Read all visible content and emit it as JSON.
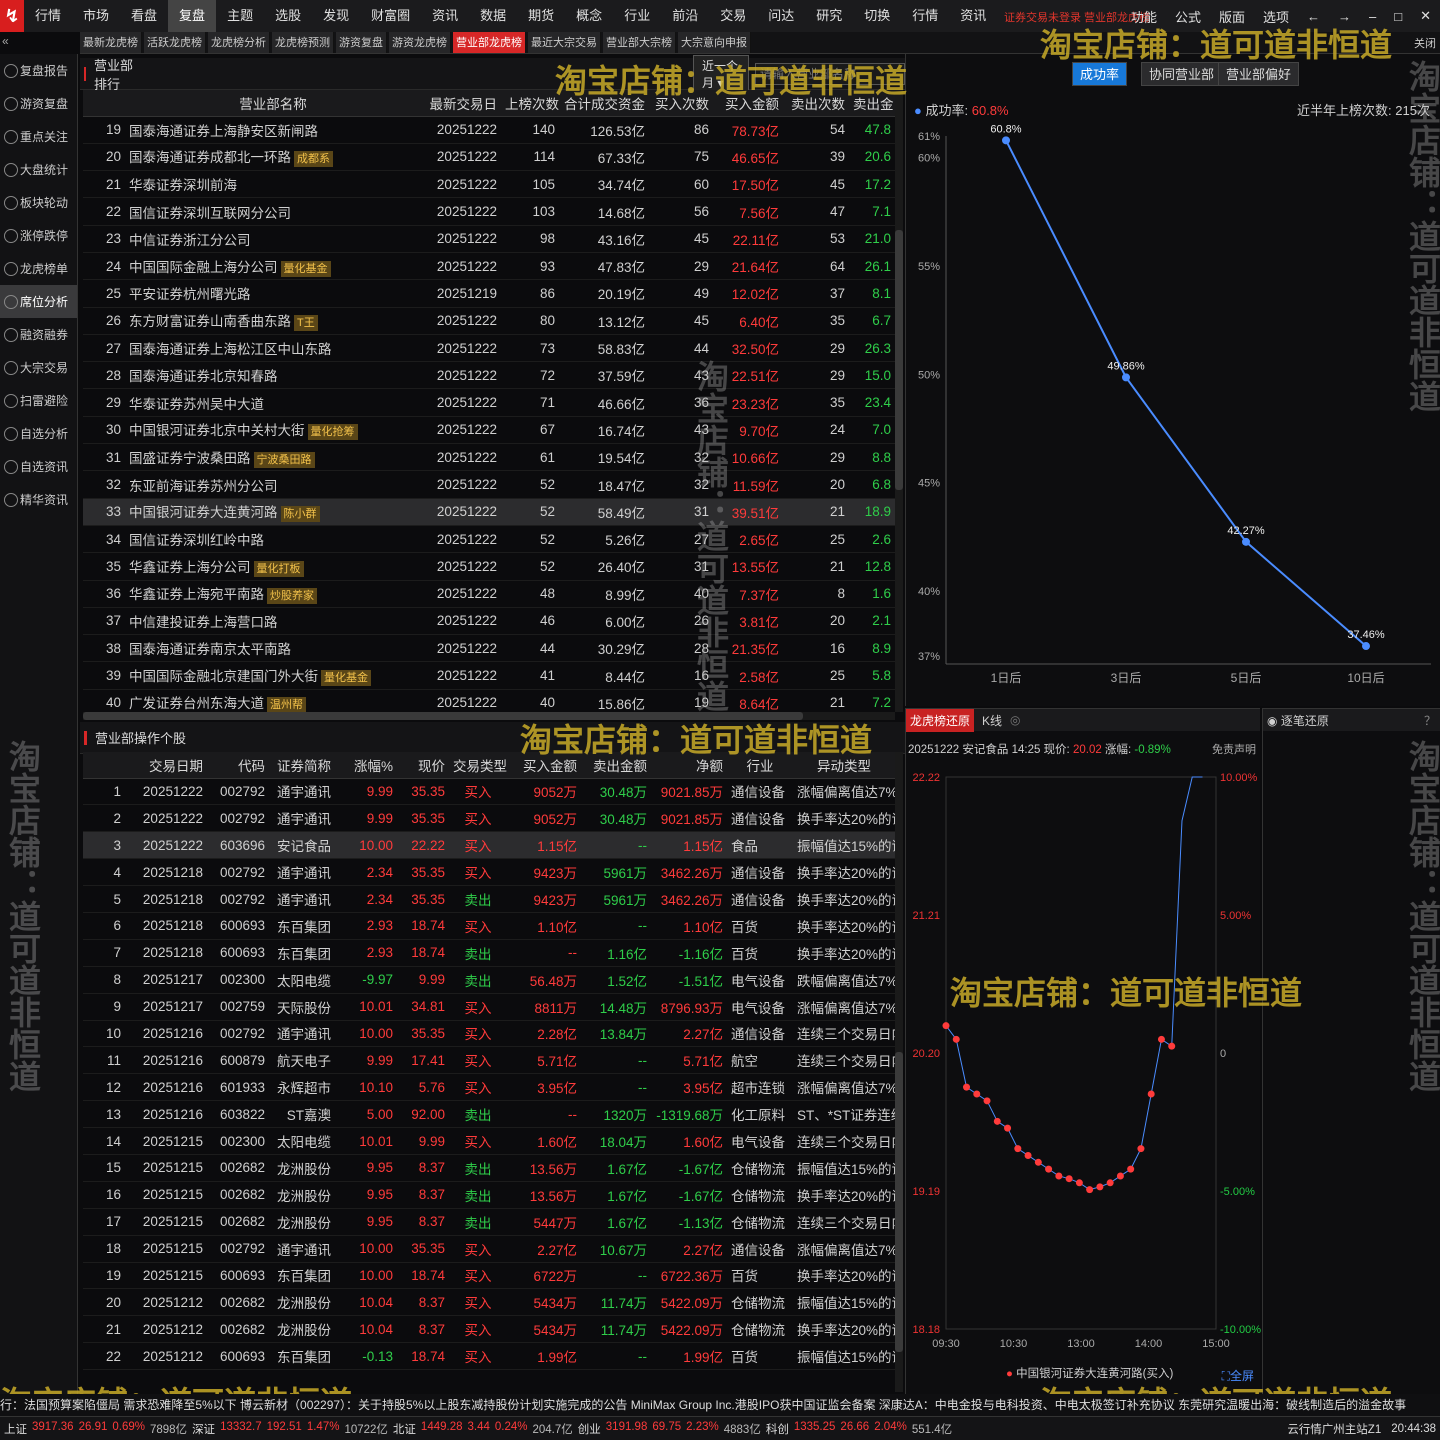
{
  "menu": [
    "行情",
    "市场",
    "看盘",
    "复盘",
    "主题",
    "选股",
    "发现",
    "财富圈",
    "资讯",
    "数据",
    "期货",
    "概念",
    "行业",
    "前沿",
    "交易",
    "问达",
    "研究",
    "切换",
    "行情",
    "资讯"
  ],
  "menu_active": 3,
  "header_red": "证券交易未登录  营业部龙虎榜",
  "right_menu": [
    "功能",
    "公式",
    "版面",
    "选项"
  ],
  "subtabs": [
    "最新龙虎榜",
    "活跃龙虎榜",
    "龙虎榜分析",
    "龙虎榜预测",
    "游资复盘",
    "游资龙虎榜",
    "营业部龙虎榜",
    "最近大宗交易",
    "营业部大宗榜",
    "大宗意向申报"
  ],
  "subtab_active": 6,
  "close_label": "关闭",
  "sidebar": [
    "复盘报告",
    "游资复盘",
    "重点关注",
    "大盘统计",
    "板块轮动",
    "涨停跌停",
    "龙虎榜单",
    "席位分析",
    "融资融券",
    "大宗交易",
    "扫雷避险",
    "自选分析",
    "自选资讯",
    "精华资讯"
  ],
  "sidebar_active": 7,
  "rank": {
    "title": "营业部排行",
    "period": "近一个月",
    "search_placeholder": "请输入营业部名称",
    "headers": [
      "",
      "营业部名称",
      "最新交易日",
      "上榜次数",
      "合计成交资金",
      "买入次数",
      "买入金额",
      "卖出次数",
      "卖出金"
    ],
    "rows": [
      [
        "19",
        "国泰海通证券上海静安区新闸路",
        "",
        "20251222",
        "140",
        "126.53亿",
        "86",
        "78.73亿",
        "54",
        "47.8"
      ],
      [
        "20",
        "国泰海通证券成都北一环路",
        "成都系",
        "20251222",
        "114",
        "67.33亿",
        "75",
        "46.65亿",
        "39",
        "20.6"
      ],
      [
        "21",
        "华泰证券深圳前海",
        "",
        "20251222",
        "105",
        "34.74亿",
        "60",
        "17.50亿",
        "45",
        "17.2"
      ],
      [
        "22",
        "国信证券深圳互联网分公司",
        "",
        "20251222",
        "103",
        "14.68亿",
        "56",
        "7.56亿",
        "47",
        "7.1"
      ],
      [
        "23",
        "中信证券浙江分公司",
        "",
        "20251222",
        "98",
        "43.16亿",
        "45",
        "22.11亿",
        "53",
        "21.0"
      ],
      [
        "24",
        "中国国际金融上海分公司",
        "量化基金",
        "20251222",
        "93",
        "47.83亿",
        "29",
        "21.64亿",
        "64",
        "26.1"
      ],
      [
        "25",
        "平安证券杭州曙光路",
        "",
        "20251219",
        "86",
        "20.19亿",
        "49",
        "12.02亿",
        "37",
        "8.1"
      ],
      [
        "26",
        "东方财富证券山南香曲东路",
        "T王",
        "20251222",
        "80",
        "13.12亿",
        "45",
        "6.40亿",
        "35",
        "6.7"
      ],
      [
        "27",
        "国泰海通证券上海松江区中山东路",
        "",
        "20251222",
        "73",
        "58.83亿",
        "44",
        "32.50亿",
        "29",
        "26.3"
      ],
      [
        "28",
        "国泰海通证券北京知春路",
        "",
        "20251222",
        "72",
        "37.59亿",
        "43",
        "22.51亿",
        "29",
        "15.0"
      ],
      [
        "29",
        "华泰证券苏州吴中大道",
        "",
        "20251222",
        "71",
        "46.66亿",
        "36",
        "23.23亿",
        "35",
        "23.4"
      ],
      [
        "30",
        "中国银河证券北京中关村大街",
        "量化抢筹",
        "20251222",
        "67",
        "16.74亿",
        "43",
        "9.70亿",
        "24",
        "7.0"
      ],
      [
        "31",
        "国盛证券宁波桑田路",
        "宁波桑田路",
        "20251222",
        "61",
        "19.54亿",
        "32",
        "10.66亿",
        "29",
        "8.8"
      ],
      [
        "32",
        "东亚前海证券苏州分公司",
        "",
        "20251222",
        "52",
        "18.47亿",
        "32",
        "11.59亿",
        "20",
        "6.8"
      ],
      [
        "33",
        "中国银河证券大连黄河路",
        "陈小群",
        "20251222",
        "52",
        "58.49亿",
        "31",
        "39.51亿",
        "21",
        "18.9"
      ],
      [
        "34",
        "国信证券深圳红岭中路",
        "",
        "20251222",
        "52",
        "5.26亿",
        "27",
        "2.65亿",
        "25",
        "2.6"
      ],
      [
        "35",
        "华鑫证券上海分公司",
        "量化打板",
        "20251222",
        "52",
        "26.40亿",
        "31",
        "13.55亿",
        "21",
        "12.8"
      ],
      [
        "36",
        "华鑫证券上海宛平南路",
        "炒股养家",
        "20251222",
        "48",
        "8.99亿",
        "40",
        "7.37亿",
        "8",
        "1.6"
      ],
      [
        "37",
        "中信建投证券上海营口路",
        "",
        "20251222",
        "46",
        "6.00亿",
        "26",
        "3.81亿",
        "20",
        "2.1"
      ],
      [
        "38",
        "国泰海通证券南京太平南路",
        "",
        "20251222",
        "44",
        "30.29亿",
        "28",
        "21.35亿",
        "16",
        "8.9"
      ],
      [
        "39",
        "中国国际金融北京建国门外大街",
        "量化基金",
        "20251222",
        "41",
        "8.44亿",
        "16",
        "2.58亿",
        "25",
        "5.8"
      ],
      [
        "40",
        "广发证券台州东海大道",
        "温州帮",
        "20251222",
        "40",
        "15.86亿",
        "19",
        "8.64亿",
        "21",
        "7.2"
      ]
    ],
    "selected_row": 14
  },
  "ops": {
    "title": "营业部操作个股",
    "headers": [
      "",
      "交易日期",
      "代码",
      "证券简称",
      "涨幅%",
      "现价",
      "交易类型",
      "买入金额",
      "卖出金额",
      "净额",
      "行业",
      "异动类型"
    ],
    "rows": [
      [
        "1",
        "20251222",
        "002792",
        "通宇通讯",
        "9.99",
        "35.35",
        "买入",
        "9052万",
        "30.48万",
        "9021.85万",
        "通信设备",
        "涨幅偏离值达7%的"
      ],
      [
        "2",
        "20251222",
        "002792",
        "通宇通讯",
        "9.99",
        "35.35",
        "买入",
        "9052万",
        "30.48万",
        "9021.85万",
        "通信设备",
        "换手率达20%的证"
      ],
      [
        "3",
        "20251222",
        "603696",
        "安记食品",
        "10.00",
        "22.22",
        "买入",
        "1.15亿",
        "--",
        "1.15亿",
        "食品",
        "振幅值达15%的证"
      ],
      [
        "4",
        "20251218",
        "002792",
        "通宇通讯",
        "2.34",
        "35.35",
        "买入",
        "9423万",
        "5961万",
        "3462.26万",
        "通信设备",
        "换手率达20%的证"
      ],
      [
        "5",
        "20251218",
        "002792",
        "通宇通讯",
        "2.34",
        "35.35",
        "卖出",
        "9423万",
        "5961万",
        "3462.26万",
        "通信设备",
        "换手率达20%的证"
      ],
      [
        "6",
        "20251218",
        "600693",
        "东百集团",
        "2.93",
        "18.74",
        "买入",
        "1.10亿",
        "--",
        "1.10亿",
        "百货",
        "换手率达20%的证"
      ],
      [
        "7",
        "20251218",
        "600693",
        "东百集团",
        "2.93",
        "18.74",
        "卖出",
        "--",
        "1.16亿",
        "-1.16亿",
        "百货",
        "换手率达20%的证"
      ],
      [
        "8",
        "20251217",
        "002300",
        "太阳电缆",
        "-9.97",
        "9.99",
        "卖出",
        "56.48万",
        "1.52亿",
        "-1.51亿",
        "电气设备",
        "跌幅偏离值达7%的"
      ],
      [
        "9",
        "20251217",
        "002759",
        "天际股份",
        "10.01",
        "34.81",
        "买入",
        "8811万",
        "14.48万",
        "8796.93万",
        "电气设备",
        "涨幅偏离值达7%的"
      ],
      [
        "10",
        "20251216",
        "002792",
        "通宇通讯",
        "10.00",
        "35.35",
        "买入",
        "2.28亿",
        "13.84万",
        "2.27亿",
        "通信设备",
        "连续三个交易日内"
      ],
      [
        "11",
        "20251216",
        "600879",
        "航天电子",
        "9.99",
        "17.41",
        "买入",
        "5.71亿",
        "--",
        "5.71亿",
        "航空",
        "连续三个交易日内"
      ],
      [
        "12",
        "20251216",
        "601933",
        "永辉超市",
        "10.10",
        "5.76",
        "买入",
        "3.95亿",
        "--",
        "3.95亿",
        "超市连锁",
        "涨幅偏离值达7%的"
      ],
      [
        "13",
        "20251216",
        "603822",
        "ST嘉澳",
        "5.00",
        "92.00",
        "卖出",
        "--",
        "1320万",
        "-1319.68万",
        "化工原料",
        "ST、*ST证券连续"
      ],
      [
        "14",
        "20251215",
        "002300",
        "太阳电缆",
        "10.01",
        "9.99",
        "买入",
        "1.60亿",
        "18.04万",
        "1.60亿",
        "电气设备",
        "连续三个交易日内"
      ],
      [
        "15",
        "20251215",
        "002682",
        "龙洲股份",
        "9.95",
        "8.37",
        "卖出",
        "13.56万",
        "1.67亿",
        "-1.67亿",
        "仓储物流",
        "振幅值达15%的证"
      ],
      [
        "16",
        "20251215",
        "002682",
        "龙洲股份",
        "9.95",
        "8.37",
        "卖出",
        "13.56万",
        "1.67亿",
        "-1.67亿",
        "仓储物流",
        "换手率达20%的证"
      ],
      [
        "17",
        "20251215",
        "002682",
        "龙洲股份",
        "9.95",
        "8.37",
        "卖出",
        "5447万",
        "1.67亿",
        "-1.13亿",
        "仓储物流",
        "连续三个交易日内"
      ],
      [
        "18",
        "20251215",
        "002792",
        "通宇通讯",
        "10.00",
        "35.35",
        "买入",
        "2.27亿",
        "10.67万",
        "2.27亿",
        "通信设备",
        "涨幅偏离值达7%的"
      ],
      [
        "19",
        "20251215",
        "600693",
        "东百集团",
        "10.00",
        "18.74",
        "买入",
        "6722万",
        "--",
        "6722.36万",
        "百货",
        "换手率达20%的证"
      ],
      [
        "20",
        "20251212",
        "002682",
        "龙洲股份",
        "10.04",
        "8.37",
        "买入",
        "5434万",
        "11.74万",
        "5422.09万",
        "仓储物流",
        "振幅值达15%的证"
      ],
      [
        "21",
        "20251212",
        "002682",
        "龙洲股份",
        "10.04",
        "8.37",
        "买入",
        "5434万",
        "11.74万",
        "5422.09万",
        "仓储物流",
        "换手率达20%的证"
      ],
      [
        "22",
        "20251212",
        "600693",
        "东百集团",
        "-0.13",
        "18.74",
        "买入",
        "1.99亿",
        "--",
        "1.99亿",
        "百货",
        "振幅值达15%的证"
      ]
    ],
    "selected_row": 2
  },
  "tabs_right": [
    "成功率",
    "协同营业部",
    "营业部偏好"
  ],
  "success": {
    "label": "成功率:",
    "value": "60.8%",
    "count_label": "近半年上榜次数:",
    "count": "215次"
  },
  "chart_data": [
    {
      "type": "line",
      "title": "",
      "categories": [
        "1日后",
        "3日后",
        "5日后",
        "10日后"
      ],
      "values": [
        60.8,
        49.86,
        42.27,
        37.46
      ],
      "data_labels": [
        "60.8%",
        "49.86%",
        "42.27%",
        "37.46%"
      ],
      "ytick_labels": [
        "61%",
        "60%",
        "55%",
        "50%",
        "45%",
        "40%",
        "37%"
      ],
      "yticks": [
        61,
        60,
        55,
        50,
        45,
        40,
        37
      ],
      "ylim": [
        37,
        61
      ],
      "color": "#4a8cff"
    },
    {
      "type": "line",
      "title": "20251222 安记食品 14:25 现价: 20.02 涨幅: -0.89%",
      "xticks": [
        "09:30",
        "10:30",
        "13:00",
        "14:00",
        "15:00"
      ],
      "left_ticks": [
        "22.22",
        "21.21",
        "20.20",
        "19.19",
        "18.18"
      ],
      "right_ticks": [
        "10.00%",
        "5.00%",
        "0",
        "-5.00%",
        "-10.00%"
      ],
      "ylim": [
        18.18,
        22.22
      ],
      "prev_close": 20.2,
      "series_name": "中国银河证券大连黄河路(买入)",
      "color": "#ff3b3b"
    }
  ],
  "kline": {
    "tabs": [
      "龙虎榜还原",
      "K线"
    ],
    "stock_info": {
      "date": "20251222",
      "name": "安记食品",
      "time": "14:25",
      "price_label": "现价:",
      "price": "20.02",
      "chg_label": "涨幅:",
      "chg": "-0.89%"
    },
    "disclaimer": "免责声明",
    "zoom_label": "全屏"
  },
  "detail": {
    "title": "逐笔还原"
  },
  "watermark": "淘宝店铺：道可道非恒道",
  "ticker": "行：法国预算案陷僵局 需求恐难降至5%以下    博云新材（002297）：关于持股5%以上股东减持股份计划实施完成的公告    MiniMax Group Inc.港股IPO获中国证监会备案    深康达A：中电金投与电科投资、中电太极签订补充协议    东莞研究温暖出海：破线制造后的溢金故事",
  "status": {
    "items": [
      {
        "t": "上证",
        "v": "3917.36",
        "c": "red"
      },
      {
        "t": "",
        "v": "26.91",
        "c": "red"
      },
      {
        "t": "",
        "v": "0.69%",
        "c": "red"
      },
      {
        "t": "",
        "v": "7898亿",
        "c": "gray"
      },
      {
        "t": "深证",
        "v": "13332.7",
        "c": "red"
      },
      {
        "t": "",
        "v": "192.51",
        "c": "red"
      },
      {
        "t": "",
        "v": "1.47%",
        "c": "red"
      },
      {
        "t": "",
        "v": "10722亿",
        "c": "gray"
      },
      {
        "t": "北证",
        "v": "1449.28",
        "c": "red"
      },
      {
        "t": "",
        "v": "3.44",
        "c": "red"
      },
      {
        "t": "",
        "v": "0.24%",
        "c": "red"
      },
      {
        "t": "",
        "v": "204.7亿",
        "c": "gray"
      },
      {
        "t": "创业",
        "v": "3191.98",
        "c": "red"
      },
      {
        "t": "",
        "v": "69.75",
        "c": "red"
      },
      {
        "t": "",
        "v": "2.23%",
        "c": "red"
      },
      {
        "t": "",
        "v": "4883亿",
        "c": "gray"
      },
      {
        "t": "科创",
        "v": "1335.25",
        "c": "red"
      },
      {
        "t": "",
        "v": "26.66",
        "c": "red"
      },
      {
        "t": "",
        "v": "2.04%",
        "c": "red"
      },
      {
        "t": "",
        "v": "551.4亿",
        "c": "gray"
      }
    ],
    "server": "云行情广州主站Z1",
    "clock": "20:44:38"
  }
}
